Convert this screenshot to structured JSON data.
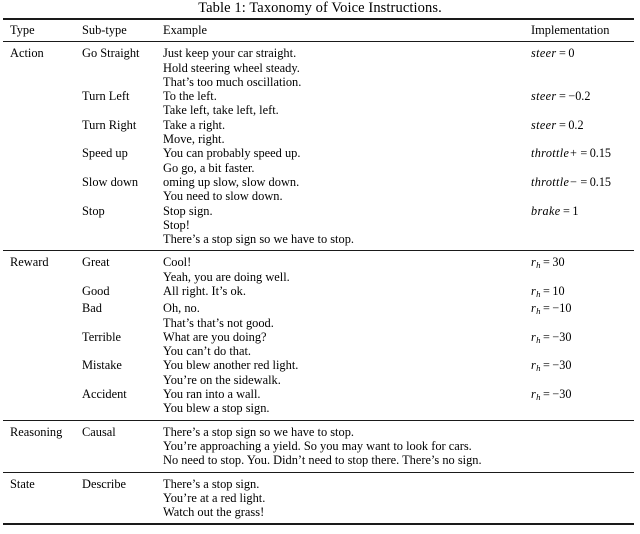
{
  "caption": "Table 1: Taxonomy of Voice Instructions.",
  "table": {
    "headers": {
      "type": "Type",
      "subtype": "Sub-type",
      "example": "Example",
      "implementation": "Implementation"
    },
    "groups": [
      {
        "type": "Action",
        "rows": [
          {
            "subtype": "Go Straight",
            "examples": [
              "Just keep your car straight.",
              "Hold steering wheel steady.",
              "That’s too much oscillation."
            ],
            "impl": {
              "var": "steer",
              "op": "=",
              "sign": "",
              "value": "0"
            }
          },
          {
            "subtype": "Turn Left",
            "examples": [
              "To the left.",
              "Take left, take left, left."
            ],
            "impl": {
              "var": "steer",
              "op": "=",
              "sign": "−",
              "value": "0.2"
            }
          },
          {
            "subtype": "Turn Right",
            "examples": [
              "Take a right.",
              "Move, right."
            ],
            "impl": {
              "var": "steer",
              "op": "=",
              "sign": "",
              "value": "0.2"
            }
          },
          {
            "subtype": "Speed up",
            "examples": [
              "You can probably speed up.",
              "Go go, a bit faster."
            ],
            "impl": {
              "var": "throttle+",
              "op": "=",
              "sign": "",
              "value": "0.15"
            }
          },
          {
            "subtype": "Slow down",
            "examples": [
              "oming up slow, slow down.",
              "You need to slow down."
            ],
            "impl": {
              "var": "throttle−",
              "op": "=",
              "sign": "",
              "value": "0.15"
            }
          },
          {
            "subtype": "Stop",
            "examples": [
              "Stop sign.",
              "Stop!",
              "There’s a stop sign so we have to stop."
            ],
            "impl": {
              "var": "brake",
              "op": "=",
              "sign": "",
              "value": "1"
            }
          }
        ]
      },
      {
        "type": "Reward",
        "rows": [
          {
            "subtype": "Great",
            "examples": [
              "Cool!",
              "Yeah, you are doing well."
            ],
            "impl": {
              "var": "r",
              "sub": "h",
              "op": "=",
              "sign": "",
              "value": "30"
            }
          },
          {
            "subtype": "Good",
            "examples": [
              "All right. It’s ok."
            ],
            "impl": {
              "var": "r",
              "sub": "h",
              "op": "=",
              "sign": "",
              "value": "10"
            }
          },
          {
            "subtype": "Bad",
            "examples": [
              "Oh, no.",
              "That’s that’s not good."
            ],
            "impl": {
              "var": "r",
              "sub": "h",
              "op": "=",
              "sign": "−",
              "value": "10"
            }
          },
          {
            "subtype": "Terrible",
            "examples": [
              "What are you doing?",
              "You can’t do that."
            ],
            "impl": {
              "var": "r",
              "sub": "h",
              "op": "=",
              "sign": "−",
              "value": "30"
            }
          },
          {
            "subtype": "Mistake",
            "examples": [
              "You blew another red light.",
              "You’re on the sidewalk."
            ],
            "impl": {
              "var": "r",
              "sub": "h",
              "op": "=",
              "sign": "−",
              "value": "30"
            }
          },
          {
            "subtype": "Accident",
            "examples": [
              "You ran into a wall.",
              "You blew a stop sign."
            ],
            "impl": {
              "var": "r",
              "sub": "h",
              "op": "=",
              "sign": "−",
              "value": "30"
            }
          }
        ]
      },
      {
        "type": "Reasoning",
        "rows": [
          {
            "subtype": "Causal",
            "examples": [
              "There’s a stop sign so we have to stop.",
              "You’re approaching a yield. So you may want to look for cars.",
              "No need to stop. You. Didn’t need to stop there. There’s no sign."
            ],
            "impl": null
          }
        ]
      },
      {
        "type": "State",
        "rows": [
          {
            "subtype": "Describe",
            "examples": [
              "There’s a stop sign.",
              "You’re at a red light.",
              "Watch out the grass!"
            ],
            "impl": null
          }
        ]
      }
    ]
  }
}
